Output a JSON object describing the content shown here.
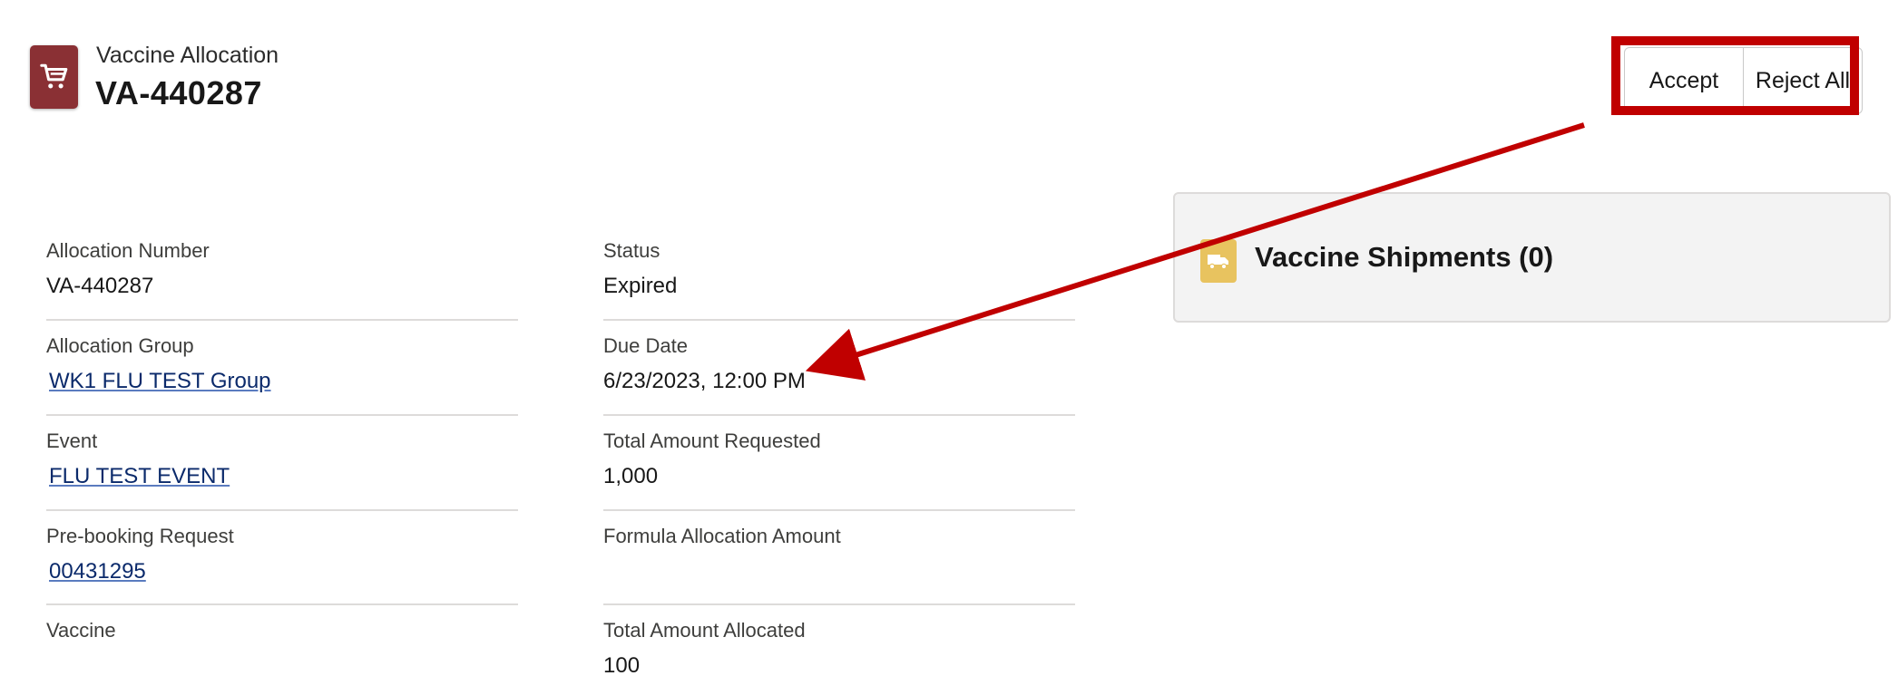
{
  "header": {
    "object_label": "Vaccine Allocation",
    "record_name": "VA-440287",
    "icon": "shopping-cart-icon",
    "icon_color": "#8a3034"
  },
  "actions": {
    "accept_label": "Accept",
    "reject_all_label": "Reject All"
  },
  "fields_left": [
    {
      "label": "Allocation Number",
      "value": "VA-440287"
    },
    {
      "label": "Allocation Group",
      "value": "WK1 FLU TEST Group"
    },
    {
      "label": "Event",
      "value": "FLU TEST EVENT"
    },
    {
      "label": "Pre-booking Request",
      "value": "00431295"
    },
    {
      "label": "Vaccine",
      "value": ""
    }
  ],
  "fields_right": [
    {
      "label": "Status",
      "value": "Expired"
    },
    {
      "label": "Due Date",
      "value": "6/23/2023, 12:00 PM"
    },
    {
      "label": "Total Amount Requested",
      "value": "1,000"
    },
    {
      "label": "Formula Allocation Amount",
      "value": ""
    },
    {
      "label": "Total Amount Allocated",
      "value": "100"
    }
  ],
  "related": {
    "title": "Vaccine Shipments (0)",
    "icon": "truck-icon",
    "icon_color": "#e8c35f"
  },
  "annotation_color": "#c00000"
}
